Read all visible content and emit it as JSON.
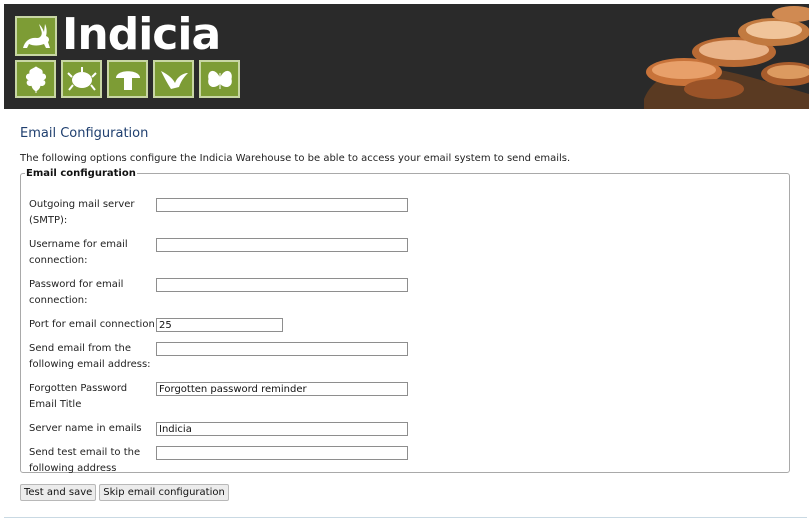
{
  "header": {
    "logo_text": "Indicia"
  },
  "page": {
    "title": "Email Configuration",
    "intro": "The following options configure the Indicia Warehouse to be able to access your email system to send emails."
  },
  "form": {
    "legend": "Email configuration",
    "fields": [
      {
        "label": "Outgoing mail server (SMTP):",
        "value": ""
      },
      {
        "label": "Username for email connection:",
        "value": ""
      },
      {
        "label": "Password for email connection:",
        "value": ""
      },
      {
        "label": "Port for email connection",
        "value": "25"
      },
      {
        "label": "Send email from the following email address:",
        "value": ""
      },
      {
        "label": "Forgotten Password Email Title",
        "value": "Forgotten password reminder"
      },
      {
        "label": "Server name in emails",
        "value": "Indicia"
      },
      {
        "label": "Send test email to the following address",
        "value": ""
      }
    ]
  },
  "buttons": {
    "test_save": "Test and save",
    "skip": "Skip email configuration"
  },
  "icons": [
    "rabbit-icon",
    "oak-leaf-icon",
    "beetle-icon",
    "mushroom-icon",
    "bird-icon",
    "butterfly-icon"
  ]
}
